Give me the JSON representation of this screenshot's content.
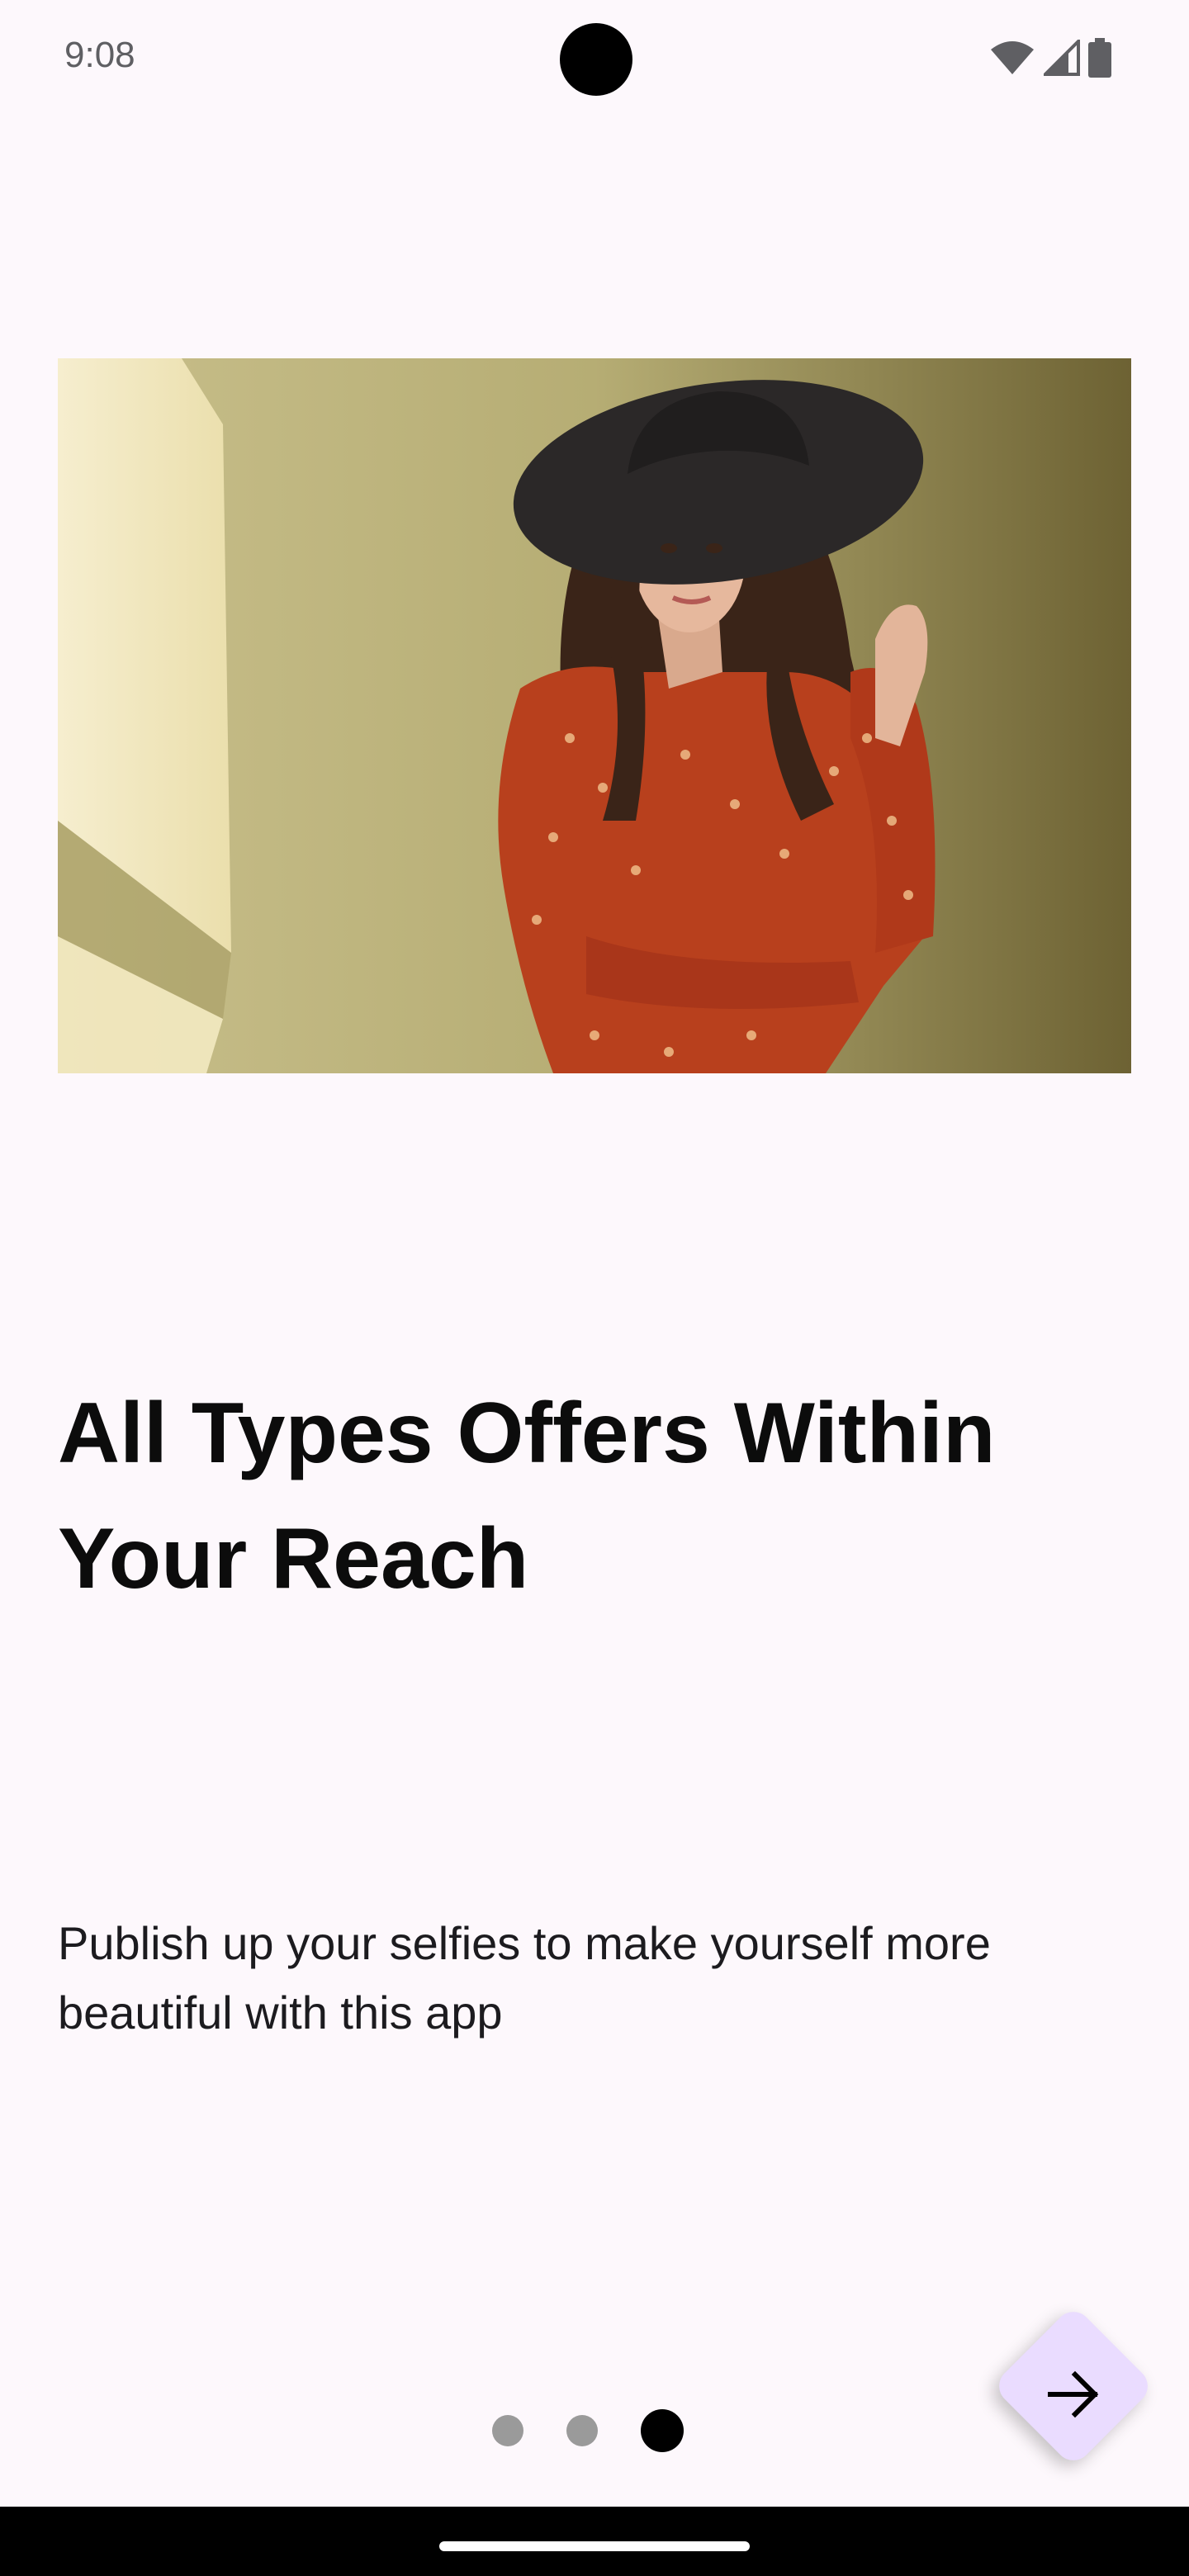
{
  "status_bar": {
    "time": "9:08",
    "icons": [
      "wifi-icon",
      "cellular-signal-icon",
      "battery-icon"
    ]
  },
  "onboarding": {
    "image": "woman-in-black-hat-photo",
    "title": "All Types Offers Within Your Reach",
    "description": "Publish up your selfies to make yourself more beautiful with this app"
  },
  "pager": {
    "total_pages": 3,
    "current_page": 3
  },
  "next_button": {
    "icon": "arrow-right-icon"
  },
  "colors": {
    "background": "#fdf8fc",
    "fab": "#eadcff",
    "active_dot": "#000000",
    "inactive_dot": "#9a9a9a"
  }
}
